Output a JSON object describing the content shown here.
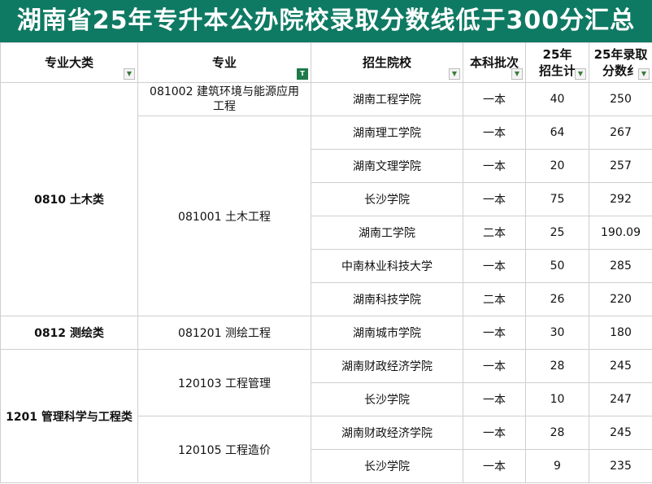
{
  "title": "湖南省25年专升本公办院校录取分数线低于300分汇总",
  "headers": {
    "category": "专业大类",
    "major": "专业",
    "school": "招生院校",
    "batch": "本科批次",
    "plan": "25年\n招生计",
    "score": "25年录取\n分数纟"
  },
  "icons": {
    "filter": "dropdown-filter-icon",
    "filter_active": "active-filter-icon"
  },
  "categories": [
    "0810 土木类",
    "0812 测绘类",
    "1201 管理科学与工程类"
  ],
  "majors": [
    "081002 建筑环境与能源应用工程",
    "081001 土木工程",
    "081201 测绘工程",
    "120103 工程管理",
    "120105 工程造价"
  ],
  "rows": [
    {
      "school": "湖南工程学院",
      "batch": "一本",
      "plan": "40",
      "score": "250"
    },
    {
      "school": "湖南理工学院",
      "batch": "一本",
      "plan": "64",
      "score": "267"
    },
    {
      "school": "湖南文理学院",
      "batch": "一本",
      "plan": "20",
      "score": "257"
    },
    {
      "school": "长沙学院",
      "batch": "一本",
      "plan": "75",
      "score": "292"
    },
    {
      "school": "湖南工学院",
      "batch": "二本",
      "plan": "25",
      "score": "190.09"
    },
    {
      "school": "中南林业科技大学",
      "batch": "一本",
      "plan": "50",
      "score": "285"
    },
    {
      "school": "湖南科技学院",
      "batch": "二本",
      "plan": "26",
      "score": "220"
    },
    {
      "school": "湖南城市学院",
      "batch": "一本",
      "plan": "30",
      "score": "180"
    },
    {
      "school": "湖南财政经济学院",
      "batch": "一本",
      "plan": "28",
      "score": "245"
    },
    {
      "school": "长沙学院",
      "batch": "一本",
      "plan": "10",
      "score": "247"
    },
    {
      "school": "湖南财政经济学院",
      "batch": "一本",
      "plan": "28",
      "score": "245"
    },
    {
      "school": "长沙学院",
      "batch": "一本",
      "plan": "9",
      "score": "235"
    }
  ]
}
